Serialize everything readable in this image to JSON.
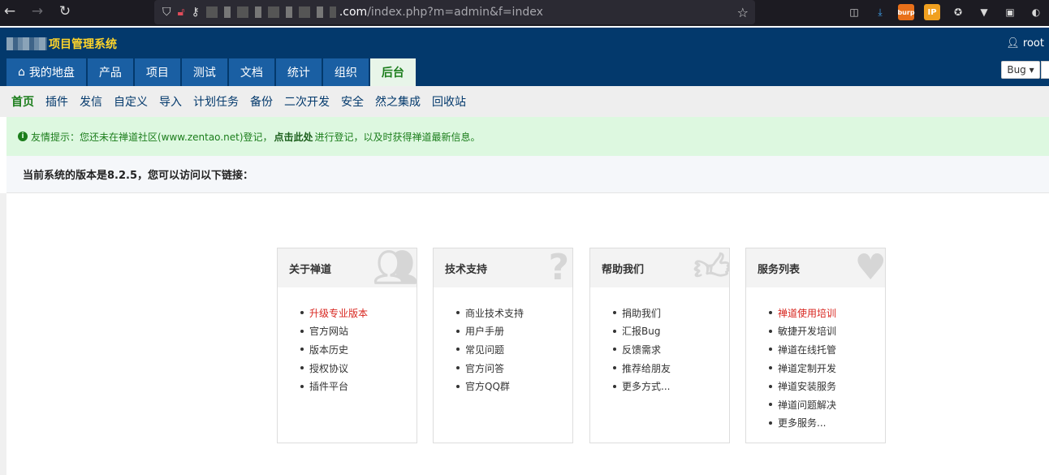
{
  "browser": {
    "url_host": ".com",
    "url_path": "/index.php?m=admin&f=index",
    "extensions": [
      "pocket-icon",
      "download-icon",
      "burp-icon",
      "ip-icon",
      "cookie-icon",
      "vue-icon",
      "z-icon",
      "o-icon"
    ],
    "burp_label": "burp",
    "ip_label": "IP"
  },
  "header": {
    "brand": "项目管理系统",
    "user": "root",
    "search_type": "Bug ▾"
  },
  "main_nav": [
    {
      "label": "我的地盘",
      "icon": "home-icon"
    },
    {
      "label": "产品"
    },
    {
      "label": "项目"
    },
    {
      "label": "测试"
    },
    {
      "label": "文档"
    },
    {
      "label": "统计"
    },
    {
      "label": "组织"
    },
    {
      "label": "后台",
      "active": true
    }
  ],
  "sub_nav": [
    "首页",
    "插件",
    "发信",
    "自定义",
    "导入",
    "计划任务",
    "备份",
    "二次开发",
    "安全",
    "然之集成",
    "回收站"
  ],
  "notice": {
    "prefix": "友情提示：您还未在禅道社区(www.zentao.net)登记，",
    "link": "点击此处",
    "suffix": "进行登记，以及时获得禅道最新信息。"
  },
  "version_text": "当前系统的版本是8.2.5，您可以访问以下链接：",
  "panels": [
    {
      "title": "关于禅道",
      "icon": "users-icon",
      "items": [
        "升级专业版本",
        "官方网站",
        "版本历史",
        "授权协议",
        "插件平台"
      ],
      "hot": [
        0
      ]
    },
    {
      "title": "技术支持",
      "icon": "question-icon",
      "items": [
        "商业技术支持",
        "用户手册",
        "常见问题",
        "官方问答",
        "官方QQ群"
      ],
      "hot": []
    },
    {
      "title": "帮助我们",
      "icon": "thumbs-up-icon",
      "items": [
        "捐助我们",
        "汇报Bug",
        "反馈需求",
        "推荐给朋友",
        "更多方式..."
      ],
      "hot": []
    },
    {
      "title": "服务列表",
      "icon": "heart-icon",
      "items": [
        "禅道使用培训",
        "敏捷开发培训",
        "禅道在线托管",
        "禅道定制开发",
        "禅道安装服务",
        "禅道问题解决",
        "更多服务..."
      ],
      "hot": [
        0
      ]
    }
  ]
}
